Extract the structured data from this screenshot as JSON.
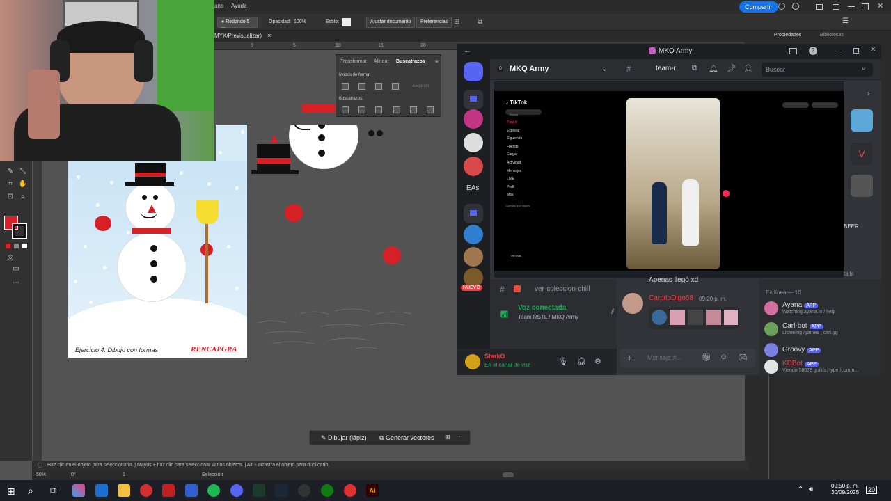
{
  "illustrator": {
    "menu": [
      "ana",
      "Ayuda"
    ],
    "share_label": "Compartir",
    "control_bar": {
      "brush": "Redondo 5 ...",
      "opacity_label": "Opacidad:",
      "opacity_value": "100%",
      "style_label": "Estilo:",
      "adjust_doc": "Ajustar documento",
      "preferences": "Preferencias"
    },
    "doc_tab": "MYK/Previsualizar)",
    "ruler_marks": [
      "0",
      "5",
      "10",
      "15",
      "20"
    ],
    "right_dock_tabs": [
      "Propiedades",
      "Bibliotecas"
    ],
    "pathfinder": {
      "tabs": [
        "Transformar",
        "Alinear",
        "Buscatrazos"
      ],
      "shape_modes_label": "Modos de forma:",
      "expand_label": "Expandir",
      "pathfinders_label": "Buscatrazos:"
    },
    "artboard1": {
      "caption": "Ejercicio 4: Dibujo con formas",
      "brand": "RENCAPGRA"
    },
    "task_bar": {
      "draw": "Dibujar (lápiz)",
      "vectors": "Generar vectores"
    },
    "status_text": "Haz clic en el objeto para seleccionarlo.  |  Mayús + haz clic para seleccionar varios objetos.  |  Alt + arrastra el objeto para duplicarlo.",
    "bottom_bar": {
      "zoom": "50%",
      "rotation": "0°",
      "artboard_num": "1",
      "mode": "Selección"
    },
    "colors": {
      "fill": "#d71f26",
      "accent": "#1473e6"
    }
  },
  "discord": {
    "window_title": "MKQ Army",
    "server_name": "MKQ Army",
    "server_count": "0",
    "channel_name": "team-r",
    "search_placeholder": "Buscar",
    "stream": {
      "app_name": "TikTok",
      "search_placeholder": "Buscar",
      "nav": [
        "Para ti",
        "Explorar",
        "Siguiendo",
        "Friends",
        "Cargar",
        "Actividad",
        "Mensajes",
        "LIVE",
        "Perfil",
        "Más"
      ],
      "following_header": "Cuentas que sigues",
      "see_more": "Ver más"
    },
    "guild_labels": {
      "eas": "EAs",
      "new": "NUEVO"
    },
    "side_badge": "BEER",
    "side_text": "talla",
    "channel_below": "ver-coleccion-chill",
    "voice": {
      "status": "Voz conectada",
      "location": "Team RSTL / MKQ Army"
    },
    "user": {
      "name": "StarkO",
      "status": "En el canal de voz"
    },
    "chat": {
      "top_text": "Apenas llegó xd",
      "author": "CarpitoDigo68",
      "time": "09:20 p. m.",
      "input_placeholder": "Mensaje #..."
    },
    "members": {
      "header": "En línea — 10",
      "list": [
        {
          "name": "Ayana",
          "tag": "APP",
          "status": "Watching ayana.io / help",
          "color": "#dbdee1"
        },
        {
          "name": "Carl-bot",
          "tag": "APP",
          "status": "Listening /games | carl.gg",
          "color": "#dbdee1"
        },
        {
          "name": "Groovy",
          "tag": "APP",
          "status": "",
          "color": "#dbdee1"
        },
        {
          "name": "KDBot",
          "tag": "APP",
          "status": "Viendo 58078 guilds; type /comm...",
          "color": "#f23f43"
        }
      ]
    }
  },
  "taskbar": {
    "time": "09:50 p. m.",
    "date": "30/09/2025",
    "notif_count": "20"
  }
}
